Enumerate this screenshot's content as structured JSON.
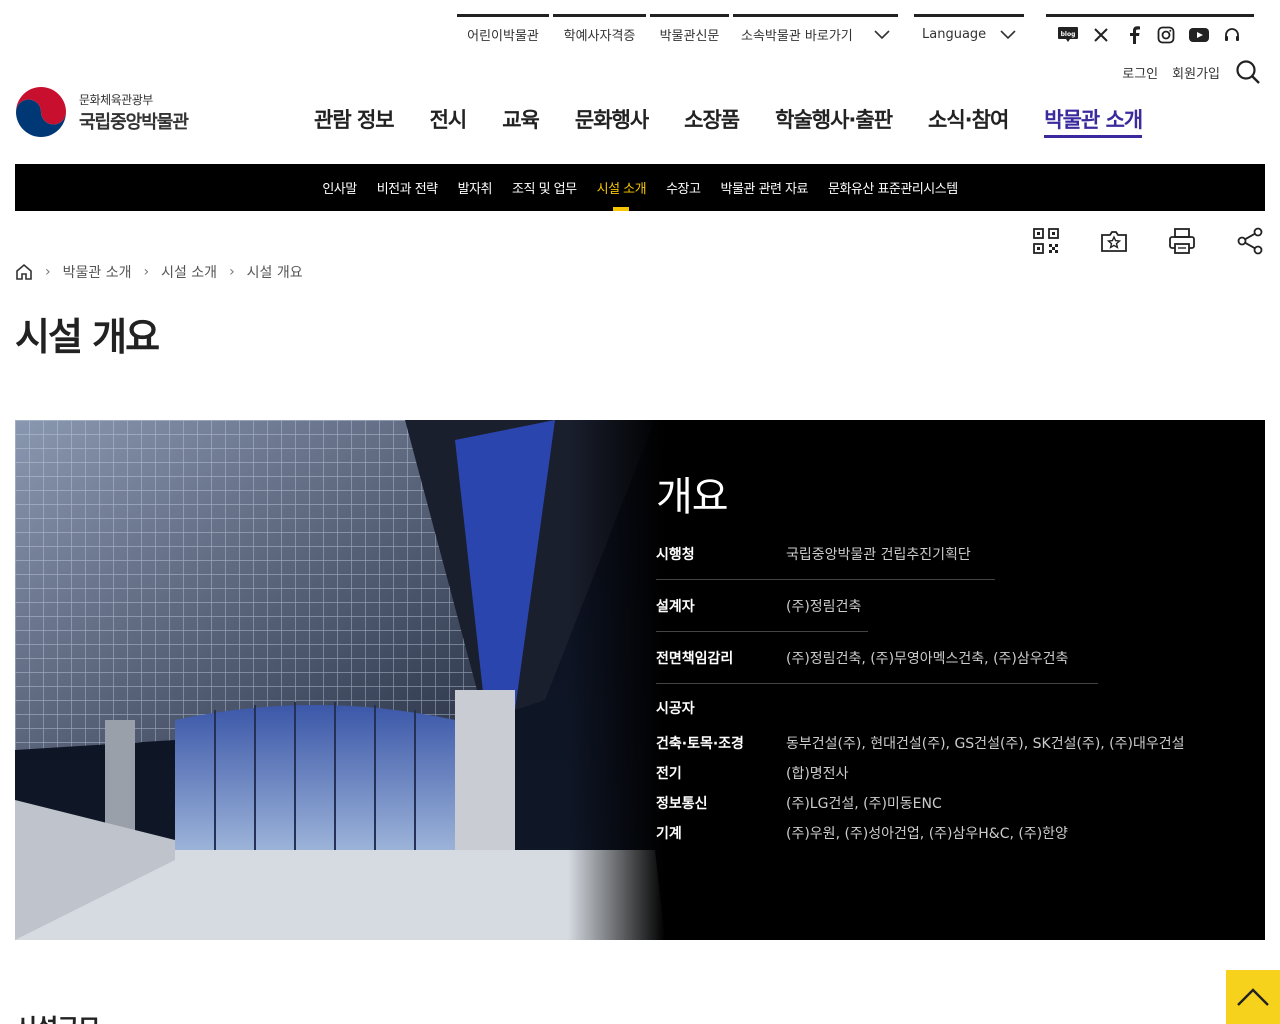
{
  "util_links": [
    "어린이박물관",
    "학예사자격증",
    "박물관신문",
    "소속박물관 바로가기"
  ],
  "language": "Language",
  "social_icons": [
    "blog-icon",
    "x-icon",
    "facebook-icon",
    "instagram-icon",
    "youtube-icon",
    "headset-icon"
  ],
  "account": {
    "login": "로그인",
    "signup": "회원가입"
  },
  "logo": {
    "sub": "문화체육관광부",
    "main": "국립중앙박물관"
  },
  "gnb": [
    "관람 정보",
    "전시",
    "교육",
    "문화행사",
    "소장품",
    "학술행사·출판",
    "소식·참여",
    "박물관 소개"
  ],
  "subnav": [
    "인사말",
    "비전과 전략",
    "발자취",
    "조직 및 업무",
    "시설 소개",
    "수장고",
    "박물관 관련 자료",
    "문화유산 표준관리시스템"
  ],
  "breadcrumb": [
    "박물관 소개",
    "시설 소개",
    "시설 개요"
  ],
  "page_title": "시설 개요",
  "overview": {
    "title": "개요",
    "rows": [
      {
        "k": "시행청",
        "v": "국립중앙박물관 건립추진기획단"
      },
      {
        "k": "설계자",
        "v": "(주)정림건축"
      },
      {
        "k": "전면책임감리",
        "v": "(주)정림건축, (주)무영아멕스건축, (주)삼우건축"
      }
    ],
    "contractor_label": "시공자",
    "contractors": [
      {
        "k": "건축·토목·조경",
        "v": "동부건설(주), 현대건설(주), GS건설(주), SK건설(주), (주)대우건설"
      },
      {
        "k": "전기",
        "v": "(합)명전사"
      },
      {
        "k": "정보통신",
        "v": "(주)LG건설, (주)미동ENC"
      },
      {
        "k": "기계",
        "v": "(주)우원, (주)성아건업, (주)삼우H&C, (주)한양"
      }
    ]
  },
  "next_section_title": "시설구모",
  "colors": {
    "accent": "#3a2a9d",
    "highlight": "#f7c600"
  }
}
